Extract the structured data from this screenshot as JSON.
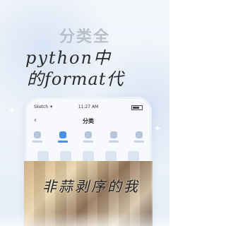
{
  "banner": {
    "heading": "分类全",
    "overlay_line1": "python中",
    "overlay_line2": "的format代",
    "caption": "非蒜剥序的我"
  },
  "phone": {
    "status_carrier": "Sketch ✦",
    "status_time": "11:27 AM",
    "nav_back_icon": "chevron-left-icon",
    "nav_title": "分类",
    "active_tab_index": 1,
    "tabs_count": 5,
    "grid_cells": 15
  },
  "colors": {
    "accent": "#4a90e2",
    "heading": "#b8c0ca",
    "text": "#2b2b2b"
  }
}
